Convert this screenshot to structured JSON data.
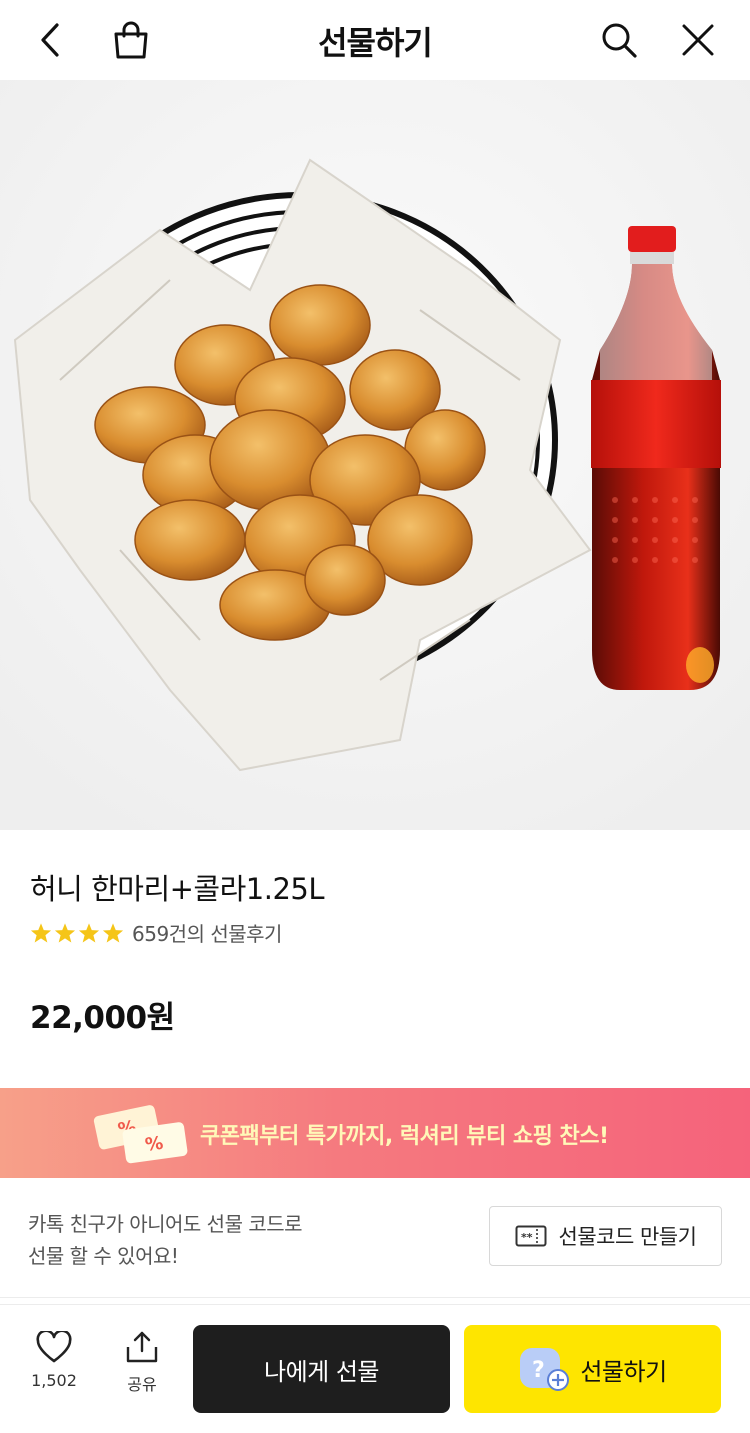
{
  "header": {
    "title": "선물하기",
    "icons": [
      "back-arrow-icon",
      "shopping-bag-icon",
      "search-icon",
      "close-icon"
    ]
  },
  "product": {
    "name": "허니 한마리+콜라1.25L",
    "rating_stars": 4,
    "review_text": "659건의 선물후기",
    "price": "22,000원"
  },
  "banner": {
    "text": "쿠폰팩부터 특가까지, 럭셔리 뷰티 쇼핑 찬스!",
    "text_color": "#fff8b8"
  },
  "gift_code": {
    "line1": "카톡 친구가 아니어도 선물 코드로",
    "line2": "선물 할 수 있어요!",
    "button_label": "선물코드 만들기"
  },
  "bottom_bar": {
    "like_count": "1,502",
    "share_label": "공유",
    "self_gift_label": "나에게 선물",
    "gift_label": "선물하기"
  },
  "colors": {
    "accent_yellow": "#fee500",
    "dark_button": "#1e1e1e",
    "star": "#f5c518"
  }
}
